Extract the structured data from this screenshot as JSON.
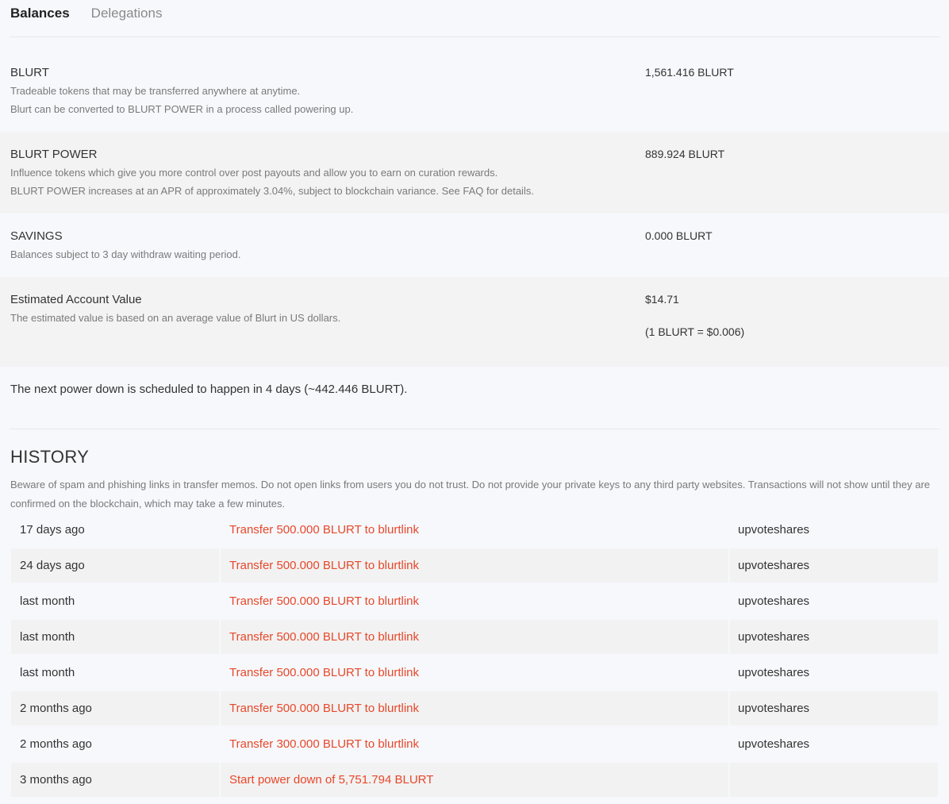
{
  "tabs": [
    {
      "label": "Balances"
    },
    {
      "label": "Delegations"
    }
  ],
  "balances": [
    {
      "title": "BLURT",
      "desc1": "Tradeable tokens that may be transferred anywhere at anytime.",
      "desc2": "Blurt can be converted to BLURT POWER in a process called powering up.",
      "value": "1,561.416 BLURT"
    },
    {
      "title": "BLURT POWER",
      "desc1": "Influence tokens which give you more control over post payouts and allow you to earn on curation rewards.",
      "desc2": "BLURT POWER increases at an APR of approximately 3.04%, subject to blockchain variance. See FAQ for details.",
      "value": "889.924 BLURT"
    },
    {
      "title": "SAVINGS",
      "desc1": "Balances subject to 3 day withdraw waiting period.",
      "value": "0.000 BLURT"
    },
    {
      "title": "Estimated Account Value",
      "desc1": "The estimated value is based on an average value of Blurt in US dollars.",
      "value": "$14.71",
      "value2": "(1 BLURT = $0.006)"
    }
  ],
  "powerdown_notice": "The next power down is scheduled to happen in 4 days (~442.446 BLURT).",
  "history": {
    "title": "HISTORY",
    "note": "Beware of spam and phishing links in transfer memos. Do not open links from users you do not trust. Do not provide your private keys to any third party websites. Transactions will not show until they are confirmed on the blockchain, which may take a few minutes.",
    "rows": [
      {
        "time": "17 days ago",
        "action": "Transfer 500.000 BLURT to blurtlink",
        "memo": "upvoteshares"
      },
      {
        "time": "24 days ago",
        "action": "Transfer 500.000 BLURT to blurtlink",
        "memo": "upvoteshares"
      },
      {
        "time": "last month",
        "action": "Transfer 500.000 BLURT to blurtlink",
        "memo": "upvoteshares"
      },
      {
        "time": "last month",
        "action": "Transfer 500.000 BLURT to blurtlink",
        "memo": "upvoteshares"
      },
      {
        "time": "last month",
        "action": "Transfer 500.000 BLURT to blurtlink",
        "memo": "upvoteshares"
      },
      {
        "time": "2 months ago",
        "action": "Transfer 500.000 BLURT to blurtlink",
        "memo": "upvoteshares"
      },
      {
        "time": "2 months ago",
        "action": "Transfer 300.000 BLURT to blurtlink",
        "memo": "upvoteshares"
      },
      {
        "time": "3 months ago",
        "action": "Start power down of 5,751.794 BLURT",
        "memo": ""
      }
    ]
  },
  "colors": {
    "background": "#f7f8fc",
    "row_shade": "#f3f3f3",
    "link_accent": "#e7482a",
    "muted_text": "#7a7a7a"
  }
}
